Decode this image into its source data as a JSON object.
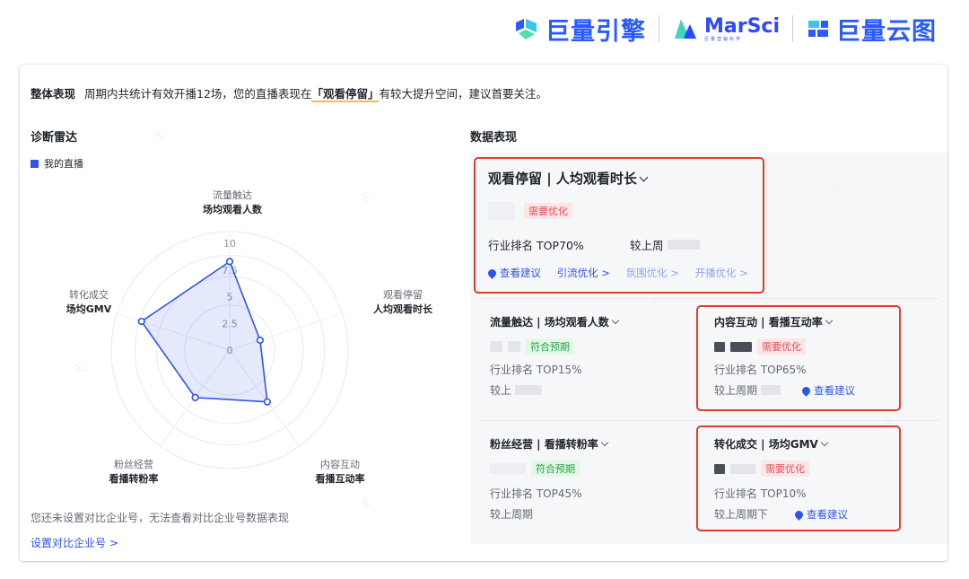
{
  "brands": {
    "juliang_engine": "巨量引擎",
    "marsci": "MarSci",
    "marsci_sub": "巨量营销科学",
    "yuntu": "巨量云图"
  },
  "overall": {
    "label": "整体表现",
    "text_before": "周期内共统计有效开播12场，您的直播表现在",
    "highlight": "「观看停留」",
    "text_after": "有较大提升空间，建议首要关注。"
  },
  "radar": {
    "title": "诊断雷达",
    "legend": "我的直播",
    "labels": [
      {
        "top": "流量触达",
        "bottom": "场均观看人数"
      },
      {
        "top": "观看停留",
        "bottom": "人均观看时长"
      },
      {
        "top": "内容互动",
        "bottom": "看播互动率"
      },
      {
        "top": "粉丝经营",
        "bottom": "看播转粉率"
      },
      {
        "top": "转化成交",
        "bottom": "场均GMV"
      }
    ],
    "ticks": [
      "0",
      "2.5",
      "5",
      "7.5",
      "10"
    ],
    "max": 10,
    "values": [
      8.3,
      3.0,
      6.0,
      5.5,
      8.7
    ],
    "color": "#2f54eb"
  },
  "note": {
    "text": "您还未设置对比企业号，无法查看对比企业号数据表现",
    "link": "设置对比企业号 >"
  },
  "data": {
    "title": "数据表现",
    "main": {
      "title": "观看停留 | 人均观看时长",
      "tag": "需要优化",
      "rank": "行业排名 TOP70%",
      "compare": "较上周",
      "links": [
        "查看建议",
        "引流优化 >",
        "氛围优化 >",
        "开播优化 >"
      ]
    },
    "cards": [
      {
        "title": "流量触达 | 场均观看人数",
        "tag": "符合预期",
        "rank": "行业排名 TOP15%",
        "compare": "较上"
      },
      {
        "title": "内容互动 | 看播互动率",
        "tag": "需要优化",
        "rank": "行业排名 TOP65%",
        "compare": "较上周期",
        "advice": "查看建议"
      },
      {
        "title": "粉丝经营 | 看播转粉率",
        "tag": "符合预期",
        "rank": "行业排名 TOP45%",
        "compare": "较上周期"
      },
      {
        "title": "转化成交 | 场均GMV",
        "tag": "需要优化",
        "rank": "行业排名 TOP10%",
        "compare": "较上周期下",
        "advice": "查看建议"
      }
    ]
  }
}
